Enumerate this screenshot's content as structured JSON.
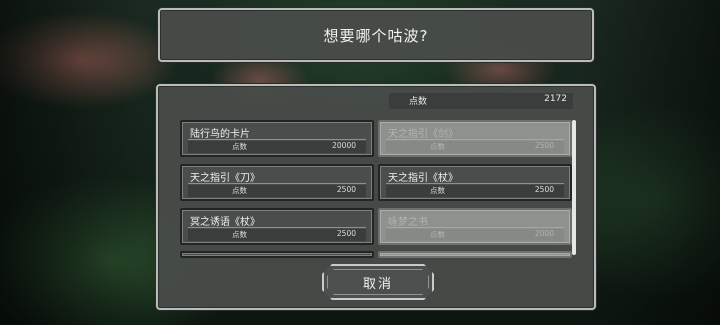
{
  "dialog": {
    "question": "想要哪个咕波?"
  },
  "shop": {
    "points_label": "点数",
    "points_value": "2172",
    "items": [
      {
        "name": "陆行鸟的卡片",
        "price_label": "点数",
        "price": "20000",
        "available": true
      },
      {
        "name": "天之指引《剑》",
        "price_label": "点数",
        "price": "2500",
        "available": false
      },
      {
        "name": "天之指引《刀》",
        "price_label": "点数",
        "price": "2500",
        "available": true
      },
      {
        "name": "天之指引《杖》",
        "price_label": "点数",
        "price": "2500",
        "available": true
      },
      {
        "name": "冥之诱语《杖》",
        "price_label": "点数",
        "price": "2500",
        "available": true
      },
      {
        "name": "咏梦之书",
        "price_label": "点数",
        "price": "2000",
        "available": false
      }
    ],
    "cancel_label": "取消"
  }
}
